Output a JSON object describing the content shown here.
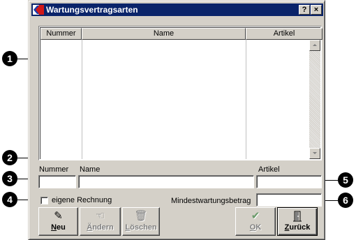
{
  "window": {
    "title": "Wartungsvertragsarten",
    "help_button": "?",
    "close_button": "×"
  },
  "list": {
    "columns": [
      "Nummer",
      "Name",
      "Artikel"
    ]
  },
  "form": {
    "nummer_label": "Nummer",
    "name_label": "Name",
    "artikel_label": "Artikel",
    "nummer_value": "",
    "name_value": "",
    "artikel_value": "",
    "eigene_rechnung_label": "eigene Rechnung",
    "eigene_rechnung_checked": false,
    "mindest_label": "Mindestwartungsbetrag",
    "mindest_value": ""
  },
  "buttons": {
    "neu": {
      "label_first": "N",
      "label_rest": "eu",
      "icon": "pencil-new-icon",
      "enabled": true
    },
    "aendern": {
      "label_first": "Ä",
      "label_rest": "ndern",
      "icon": "hand-edit-icon",
      "enabled": false
    },
    "loeschen": {
      "label_first": "L",
      "label_rest": "öschen",
      "icon": "trash-icon",
      "enabled": false
    },
    "ok": {
      "label_first": "O",
      "label_rest": "K",
      "icon": "checkmark-icon",
      "enabled": false
    },
    "zurueck": {
      "label_first": "Z",
      "label_rest": "urück",
      "icon": "door-exit-icon",
      "enabled": true
    }
  },
  "markers": [
    "1",
    "2",
    "3",
    "4",
    "5",
    "6"
  ],
  "colors": {
    "titlebar": "#0a246a",
    "face": "#d4d0c8",
    "app_icon_red": "#d01818"
  }
}
